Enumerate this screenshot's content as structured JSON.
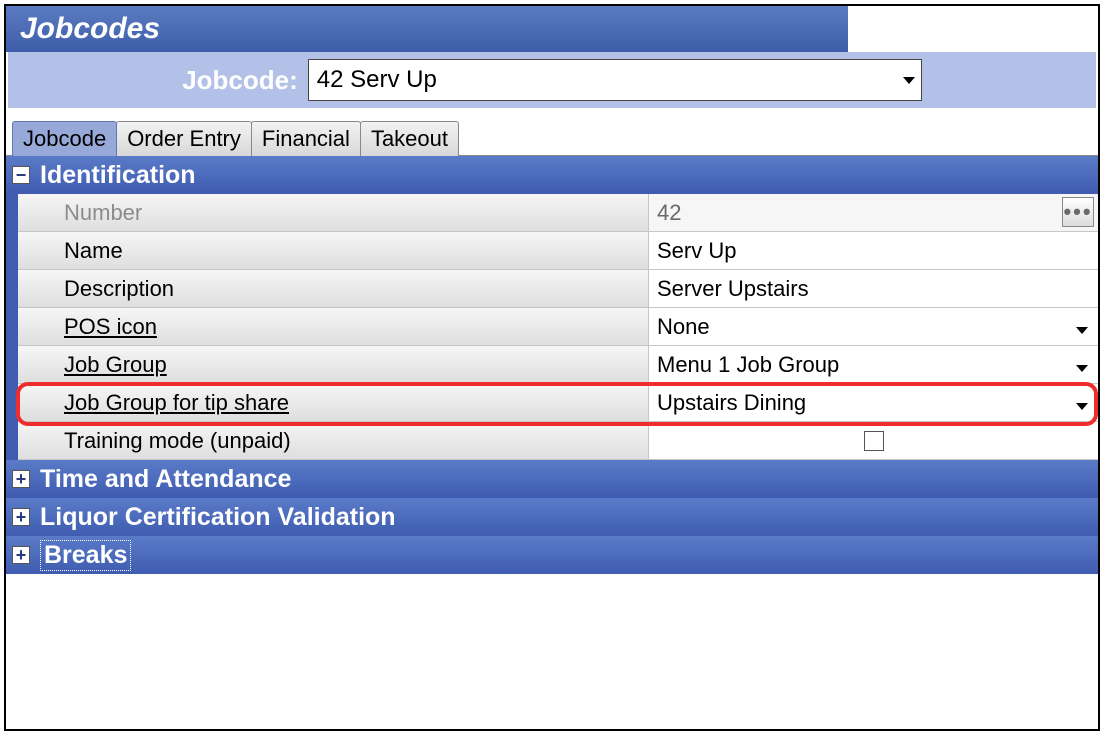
{
  "window": {
    "title": "Jobcodes"
  },
  "selector": {
    "label": "Jobcode:",
    "value": "42 Serv Up"
  },
  "tabs": {
    "items": [
      "Jobcode",
      "Order Entry",
      "Financial",
      "Takeout"
    ],
    "active_index": 0
  },
  "sections": {
    "identification": {
      "title": "Identification",
      "expanded": true,
      "rows": {
        "number": {
          "label": "Number",
          "value": "42",
          "type": "ellipsis",
          "dim": true
        },
        "name": {
          "label": "Name",
          "value": "Serv Up",
          "type": "text"
        },
        "desc": {
          "label": "Description",
          "value": "Server Upstairs",
          "type": "text"
        },
        "posicon": {
          "label": "POS icon",
          "value": "None",
          "type": "dropdown",
          "underline": true
        },
        "jobgroup": {
          "label": "Job Group",
          "value": "Menu 1 Job Group",
          "type": "dropdown",
          "underline": true
        },
        "jgtips": {
          "label": "Job Group for tip share",
          "value": "Upstairs Dining",
          "type": "dropdown",
          "underline": true,
          "highlight": true
        },
        "training": {
          "label": "Training mode (unpaid)",
          "value": "",
          "type": "checkbox",
          "checked": false
        }
      }
    },
    "time": {
      "title": "Time and Attendance",
      "expanded": false
    },
    "liquor": {
      "title": "Liquor Certification Validation",
      "expanded": false
    },
    "breaks": {
      "title": "Breaks",
      "expanded": false,
      "focused": true
    }
  },
  "icons": {
    "minus": "−",
    "plus": "+",
    "ellipsis": "•••"
  }
}
